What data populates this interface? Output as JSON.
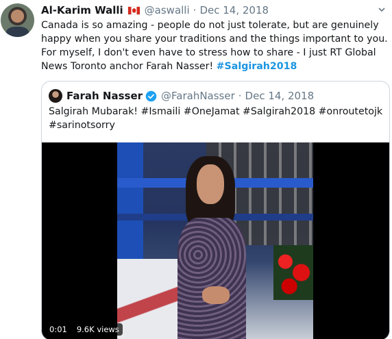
{
  "tweet": {
    "name": "Al-Karim Walli",
    "flag_icon": "canada-flag-icon",
    "handle": "@aswalli",
    "dot": "·",
    "date": "Dec 14, 2018",
    "text": "Canada is so amazing - people do not just tolerate, but are genuinely happy when you share your traditions and the things important to you. For myself, I don't even have to stress how to share - I just RT Global News Toronto anchor Farah Nasser! ",
    "hashtag": "#Salgirah2018"
  },
  "quoted": {
    "name": "Farah Nasser",
    "verified_icon": "verified-badge-icon",
    "handle": "@FarahNasser",
    "dot": "·",
    "date": "Dec 14, 2018",
    "text": "Salgirah Mubarak! #Ismaili #OneJamat #Salgirah2018 #onroutetojk #sarinotsorry",
    "video": {
      "time": "0:01",
      "views": "9.6K views"
    }
  },
  "colors": {
    "link": "#1b95e0",
    "muted": "#657786",
    "border": "#ccd6dd",
    "verified": "#1da1f2"
  }
}
